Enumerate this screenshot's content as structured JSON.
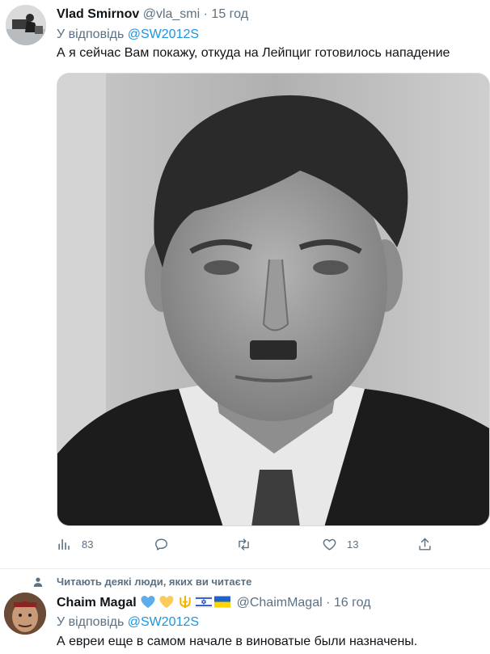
{
  "tweet1": {
    "name": "Vlad Smirnov",
    "handle": "@vla_smi",
    "dot": "·",
    "time": "15 год",
    "reply_prefix": "У відповідь",
    "reply_to": "@SW2012S",
    "text": "А я сейчас Вам покажу, откуда на Лейпциг готовилось нападение",
    "stats": {
      "views": "83",
      "comments": "",
      "retweets": "",
      "likes": "13"
    }
  },
  "tweet2": {
    "social_context": "Читають деякі люди, яких ви читаєте",
    "name": "Chaim Magal",
    "handle": "@ChaimMagal",
    "dot": "·",
    "time": "16 год",
    "reply_prefix": "У відповідь",
    "reply_to": "@SW2012S",
    "text": "А евреи еще в самом начале в виноватые были назначены."
  },
  "icons": {
    "views": "bar-chart-icon",
    "comment": "comment-bubble-icon",
    "retweet": "retweet-icon",
    "like": "heart-icon",
    "share": "share-upload-icon",
    "person": "person-icon"
  },
  "colors": {
    "link": "#1b95e0",
    "muted": "#5b7083",
    "text": "#0f1419"
  }
}
